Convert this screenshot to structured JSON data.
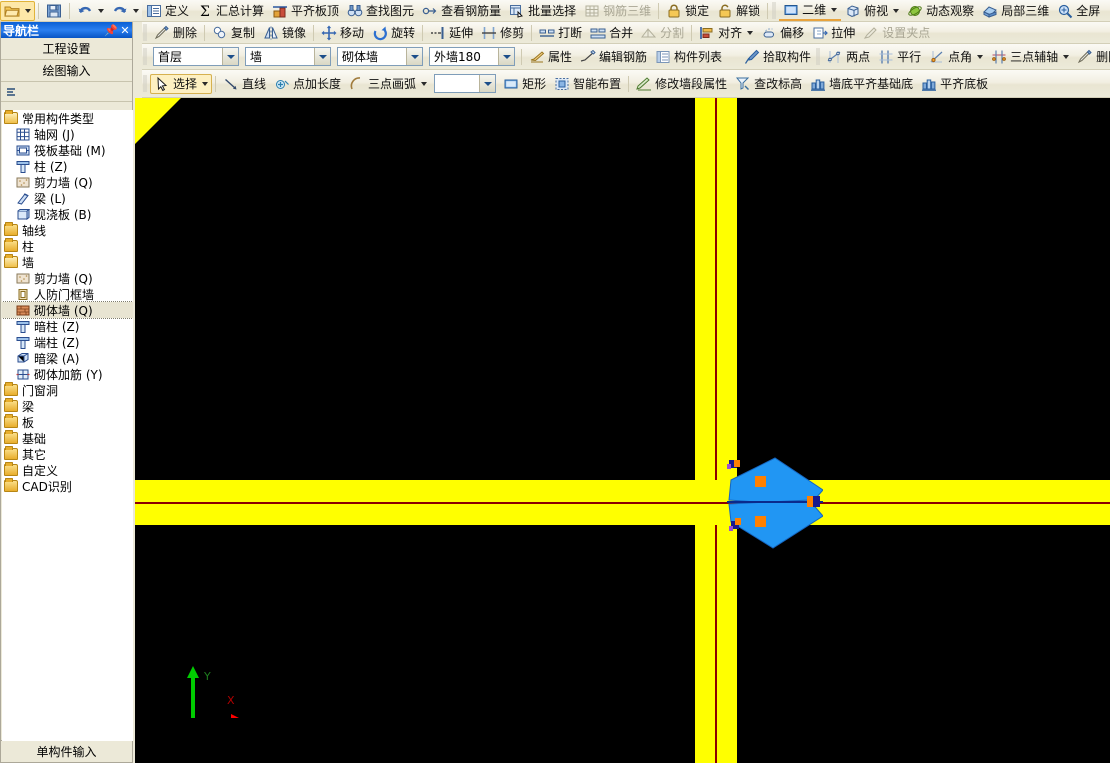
{
  "quick_access": {
    "items": [
      {
        "name": "open-icon",
        "label": "",
        "tip": "打开"
      },
      {
        "name": "save-icon",
        "label": "",
        "tip": "保存"
      },
      {
        "name": "undo-icon",
        "label": "",
        "tip": "撤销"
      },
      {
        "name": "redo-icon",
        "label": "",
        "tip": "恢复"
      }
    ]
  },
  "toolbar_row1": {
    "items": [
      {
        "label": "定义",
        "icon": "define-icon",
        "disabled": false,
        "caret": false
      },
      {
        "label": "汇总计算",
        "icon": "sigma-icon",
        "disabled": false,
        "caret": false
      },
      {
        "label": "平齐板顶",
        "icon": "align-slab-top-icon",
        "disabled": false,
        "caret": false
      },
      {
        "label": "查找图元",
        "icon": "binoculars-icon",
        "disabled": false,
        "caret": false
      },
      {
        "label": "查看钢筋量",
        "icon": "rebar-view-icon",
        "disabled": false,
        "caret": false
      },
      {
        "label": "批量选择",
        "icon": "batch-select-icon",
        "disabled": false,
        "caret": false
      },
      {
        "label": "钢筋三维",
        "icon": "rebar-3d-icon",
        "disabled": true,
        "caret": false
      },
      {
        "label": "锁定",
        "icon": "lock-icon",
        "disabled": false,
        "caret": false
      },
      {
        "label": "解锁",
        "icon": "unlock-icon",
        "disabled": false,
        "caret": false
      },
      {
        "label": "二维",
        "icon": "view-2d-icon",
        "disabled": false,
        "caret": true
      },
      {
        "label": "俯视",
        "icon": "top-view-icon",
        "disabled": false,
        "caret": true
      },
      {
        "label": "动态观察",
        "icon": "orbit-icon",
        "disabled": false,
        "caret": false
      },
      {
        "label": "局部三维",
        "icon": "local-3d-icon",
        "disabled": false,
        "caret": false
      },
      {
        "label": "全屏",
        "icon": "fullscreen-icon",
        "disabled": false,
        "caret": false
      }
    ]
  },
  "toolbar_row2": {
    "items": [
      {
        "label": "删除",
        "icon": "delete-icon",
        "disabled": false,
        "caret": false
      },
      {
        "label": "复制",
        "icon": "copy-icon",
        "disabled": false,
        "caret": false
      },
      {
        "label": "镜像",
        "icon": "mirror-icon",
        "disabled": false,
        "caret": false
      },
      {
        "label": "移动",
        "icon": "move-icon",
        "disabled": false,
        "caret": false
      },
      {
        "label": "旋转",
        "icon": "rotate-icon",
        "disabled": false,
        "caret": false
      },
      {
        "label": "延伸",
        "icon": "extend-icon",
        "disabled": false,
        "caret": false
      },
      {
        "label": "修剪",
        "icon": "trim-icon",
        "disabled": false,
        "caret": false
      },
      {
        "label": "打断",
        "icon": "break-icon",
        "disabled": false,
        "caret": false
      },
      {
        "label": "合并",
        "icon": "merge-icon",
        "disabled": false,
        "caret": false
      },
      {
        "label": "分割",
        "icon": "split-icon",
        "disabled": true,
        "caret": false
      },
      {
        "label": "对齐",
        "icon": "align-icon",
        "disabled": false,
        "caret": true
      },
      {
        "label": "偏移",
        "icon": "offset-icon",
        "disabled": false,
        "caret": false
      },
      {
        "label": "拉伸",
        "icon": "stretch-icon",
        "disabled": false,
        "caret": false
      },
      {
        "label": "设置夹点",
        "icon": "grip-point-icon",
        "disabled": true,
        "caret": false
      }
    ]
  },
  "toolbar_row3": {
    "combos": [
      {
        "name": "floor-select",
        "value": "首层",
        "width": 86
      },
      {
        "name": "component-type-select",
        "value": "墙",
        "width": 86
      },
      {
        "name": "wall-kind-select",
        "value": "砌体墙",
        "width": 86
      },
      {
        "name": "wall-instance-select",
        "value": "外墙180",
        "width": 86
      }
    ],
    "items": [
      {
        "label": "属性",
        "icon": "properties-icon",
        "disabled": false,
        "caret": false
      },
      {
        "label": "编辑钢筋",
        "icon": "edit-rebar-icon",
        "disabled": false,
        "caret": false
      },
      {
        "label": "构件列表",
        "icon": "component-list-icon",
        "disabled": false,
        "caret": false
      },
      {
        "label": "拾取构件",
        "icon": "pick-component-icon",
        "disabled": false,
        "caret": false
      }
    ],
    "aux_items": [
      {
        "label": "两点",
        "icon": "two-point-axis-icon",
        "disabled": false,
        "caret": false
      },
      {
        "label": "平行",
        "icon": "parallel-axis-icon",
        "disabled": false,
        "caret": false
      },
      {
        "label": "点角",
        "icon": "point-angle-axis-icon",
        "disabled": false,
        "caret": true
      },
      {
        "label": "三点辅轴",
        "icon": "three-point-axis-icon",
        "disabled": false,
        "caret": true
      },
      {
        "label": "删除辅轴",
        "icon": "delete-axis-icon",
        "disabled": false,
        "caret": false
      }
    ]
  },
  "toolbar_row4": {
    "select_tool": {
      "label": "选择",
      "icon": "cursor-icon",
      "active": true,
      "caret": true
    },
    "draw_items": [
      {
        "label": "直线",
        "icon": "line-icon",
        "disabled": false,
        "caret": false
      },
      {
        "label": "点加长度",
        "icon": "point-length-icon",
        "disabled": false,
        "caret": false
      },
      {
        "label": "三点画弧",
        "icon": "three-point-arc-icon",
        "disabled": false,
        "caret": true
      }
    ],
    "empty_combo": {
      "name": "arc-option-select",
      "value": "",
      "width": 62
    },
    "more_items": [
      {
        "label": "矩形",
        "icon": "rectangle-icon",
        "disabled": false,
        "caret": false
      },
      {
        "label": "智能布置",
        "icon": "smart-layout-icon",
        "disabled": false,
        "caret": true
      }
    ],
    "wall_items": [
      {
        "label": "修改墙段属性",
        "icon": "edit-wall-segment-icon",
        "disabled": false,
        "caret": false
      },
      {
        "label": "查改标高",
        "icon": "check-elevation-icon",
        "disabled": false,
        "caret": false
      },
      {
        "label": "墙底平齐基础底",
        "icon": "align-wall-base-icon",
        "disabled": false,
        "caret": false
      },
      {
        "label": "平齐底板",
        "icon": "align-bottom-slab-icon",
        "disabled": false,
        "caret": false
      }
    ]
  },
  "nav_panel": {
    "title": "导航栏",
    "pin_icon": "pin-icon",
    "close_icon": "close-icon",
    "buttons": [
      {
        "name": "project-settings-button",
        "label": "工程设置"
      },
      {
        "name": "drawing-input-button",
        "label": "绘图输入"
      }
    ],
    "footer_label": "单构件输入",
    "tree": [
      {
        "level": 1,
        "label": "常用构件类型",
        "icon": "folder-open-icon",
        "selected": false
      },
      {
        "level": 2,
        "label": "轴网 (J)",
        "icon": "axis-grid-icon",
        "selected": false
      },
      {
        "level": 2,
        "label": "筏板基础 (M)",
        "icon": "raft-foundation-icon",
        "selected": false
      },
      {
        "level": 2,
        "label": "柱 (Z)",
        "icon": "column-icon",
        "selected": false
      },
      {
        "level": 2,
        "label": "剪力墙 (Q)",
        "icon": "shear-wall-icon",
        "selected": false
      },
      {
        "level": 2,
        "label": "梁 (L)",
        "icon": "beam-icon",
        "selected": false
      },
      {
        "level": 2,
        "label": "现浇板 (B)",
        "icon": "cast-slab-icon",
        "selected": false
      },
      {
        "level": 1,
        "label": "轴线",
        "icon": "folder-icon",
        "selected": false
      },
      {
        "level": 1,
        "label": "柱",
        "icon": "folder-icon",
        "selected": false
      },
      {
        "level": 1,
        "label": "墙",
        "icon": "folder-open-icon",
        "selected": false
      },
      {
        "level": 2,
        "label": "剪力墙 (Q)",
        "icon": "shear-wall-icon",
        "selected": false
      },
      {
        "level": 2,
        "label": "人防门框墙",
        "icon": "air-defense-wall-icon",
        "selected": false
      },
      {
        "level": 2,
        "label": "砌体墙 (Q)",
        "icon": "masonry-wall-icon",
        "selected": true
      },
      {
        "level": 2,
        "label": "暗柱 (Z)",
        "icon": "hidden-column-icon",
        "selected": false
      },
      {
        "level": 2,
        "label": "端柱 (Z)",
        "icon": "end-column-icon",
        "selected": false
      },
      {
        "level": 2,
        "label": "暗梁 (A)",
        "icon": "hidden-beam-icon",
        "selected": false
      },
      {
        "level": 2,
        "label": "砌体加筋 (Y)",
        "icon": "masonry-rebar-icon",
        "selected": false
      },
      {
        "level": 1,
        "label": "门窗洞",
        "icon": "folder-icon",
        "selected": false
      },
      {
        "level": 1,
        "label": "梁",
        "icon": "folder-icon",
        "selected": false
      },
      {
        "level": 1,
        "label": "板",
        "icon": "folder-icon",
        "selected": false
      },
      {
        "level": 1,
        "label": "基础",
        "icon": "folder-icon",
        "selected": false
      },
      {
        "level": 1,
        "label": "其它",
        "icon": "folder-icon",
        "selected": false
      },
      {
        "level": 1,
        "label": "自定义",
        "icon": "folder-icon",
        "selected": false
      },
      {
        "level": 1,
        "label": "CAD识别",
        "icon": "folder-icon",
        "selected": false
      }
    ]
  },
  "canvas": {
    "background_color": "#000000",
    "wall_color": "#ffff00",
    "axis_color": "#8b0000",
    "selection_fill": "#2196f3",
    "selection_handle_color": "#ff8000",
    "selection_endpoint_color": "#1a1a8c",
    "axis_indicator": {
      "x_label": "X",
      "x_color": "#ff0000",
      "y_label": "Y",
      "y_color": "#00cc00"
    }
  }
}
